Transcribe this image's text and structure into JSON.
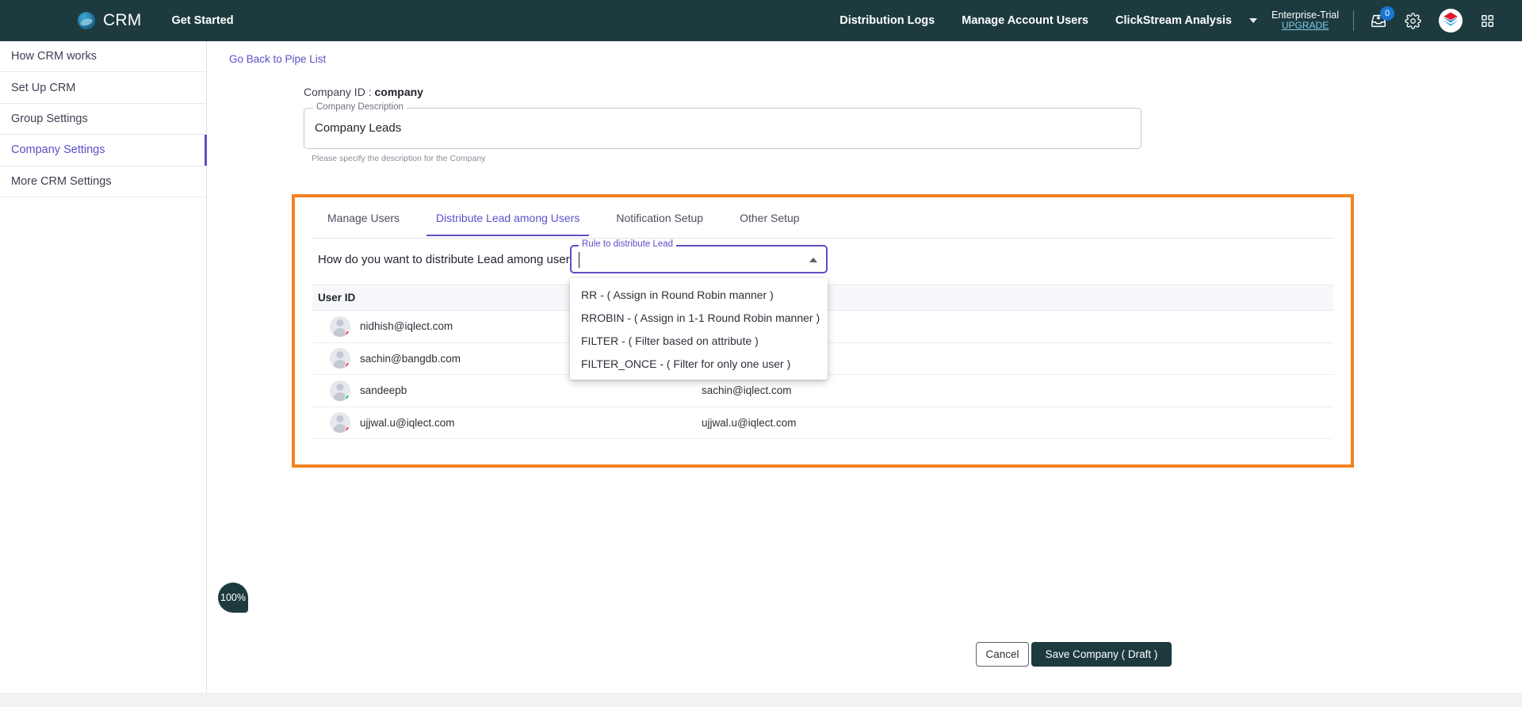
{
  "topbar": {
    "brand": "CRM",
    "get_started": "Get Started",
    "nav": [
      {
        "label": "Distribution Logs",
        "caret": false
      },
      {
        "label": "Manage Account Users",
        "caret": false
      },
      {
        "label": "ClickStream Analysis",
        "caret": true
      }
    ],
    "plan_name": "Enterprise-Trial",
    "plan_upgrade": "UPGRADE",
    "notification_count": "0",
    "colors": {
      "bar_bg": "#1d3b3f",
      "badge": "#1976d2",
      "upgrade_link": "#7fc9ea"
    }
  },
  "sidebar": {
    "items": [
      {
        "label": "How CRM works",
        "active": false
      },
      {
        "label": "Set Up CRM",
        "active": false
      },
      {
        "label": "Group Settings",
        "active": false
      },
      {
        "label": "Company Settings",
        "active": true
      },
      {
        "label": "More CRM Settings",
        "active": false
      }
    ]
  },
  "main": {
    "go_back": "Go Back to Pipe List",
    "company_id_label": "Company ID : ",
    "company_id_value": "company",
    "description_legend": "Company Description",
    "description_value": "Company Leads",
    "description_help": "Please specify the description for the Company"
  },
  "panel": {
    "border_color": "#f28322",
    "tabs": [
      {
        "label": "Manage Users",
        "active": false
      },
      {
        "label": "Distribute Lead among Users",
        "active": true
      },
      {
        "label": "Notification Setup",
        "active": false
      },
      {
        "label": "Other Setup",
        "active": false
      }
    ],
    "question": "How do you want to distribute Lead among users?",
    "select": {
      "legend": "Rule to distribute Lead",
      "value": "",
      "expanded": true,
      "options": [
        "RR - ( Assign in Round Robin manner )",
        "RROBIN - ( Assign in 1-1 Round Robin manner )",
        "FILTER - ( Filter based on attribute )",
        "FILTER_ONCE - ( Filter for only one user )"
      ]
    },
    "table": {
      "columns": [
        "User ID",
        ""
      ],
      "rows": [
        {
          "user_id": "nidhish@iqlect.com",
          "status": "offline",
          "status_color": "#ef5350",
          "assigned": ""
        },
        {
          "user_id": "sachin@bangdb.com",
          "status": "offline",
          "status_color": "#ef5350",
          "assigned": ""
        },
        {
          "user_id": "sandeepb",
          "status": "online",
          "status_color": "#33c75a",
          "assigned": "sachin@iqlect.com"
        },
        {
          "user_id": "ujjwal.u@iqlect.com",
          "status": "offline",
          "status_color": "#ef5350",
          "assigned": "ujjwal.u@iqlect.com"
        }
      ]
    }
  },
  "footer": {
    "cancel_label": "Cancel",
    "save_label": "Save Company ( Draft )"
  },
  "zoom_badge": "100%"
}
